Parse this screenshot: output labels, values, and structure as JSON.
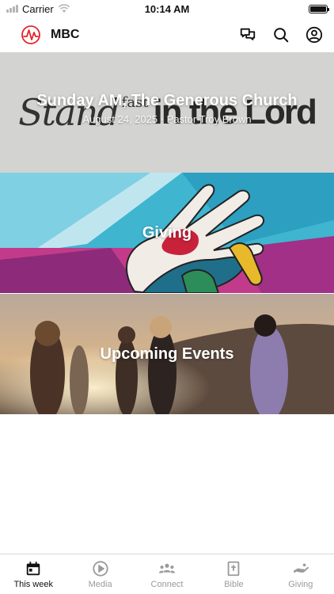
{
  "status_bar": {
    "carrier": "Carrier",
    "time": "10:14 AM"
  },
  "header": {
    "title": "MBC",
    "icons": [
      "logo-icon",
      "chat-icon",
      "search-icon",
      "profile-icon"
    ]
  },
  "cards": [
    {
      "title": "Sunday AM, The Generous Church",
      "subtitle": "August 24, 2025 · Pastor Troy Brown",
      "background_text": [
        "Stand",
        "fast",
        "in the Lord"
      ]
    },
    {
      "title": "Giving"
    },
    {
      "title": "Upcoming Events"
    }
  ],
  "tabs": [
    {
      "label": "This week",
      "icon": "calendar-icon",
      "active": true
    },
    {
      "label": "Media",
      "icon": "play-icon",
      "active": false
    },
    {
      "label": "Connect",
      "icon": "people-icon",
      "active": false
    },
    {
      "label": "Bible",
      "icon": "bible-icon",
      "active": false
    },
    {
      "label": "Giving",
      "icon": "giving-hand-icon",
      "active": false
    }
  ],
  "colors": {
    "active_tab": "#111111",
    "inactive_tab": "#9a9a9a",
    "logo_red": "#e4262b"
  }
}
